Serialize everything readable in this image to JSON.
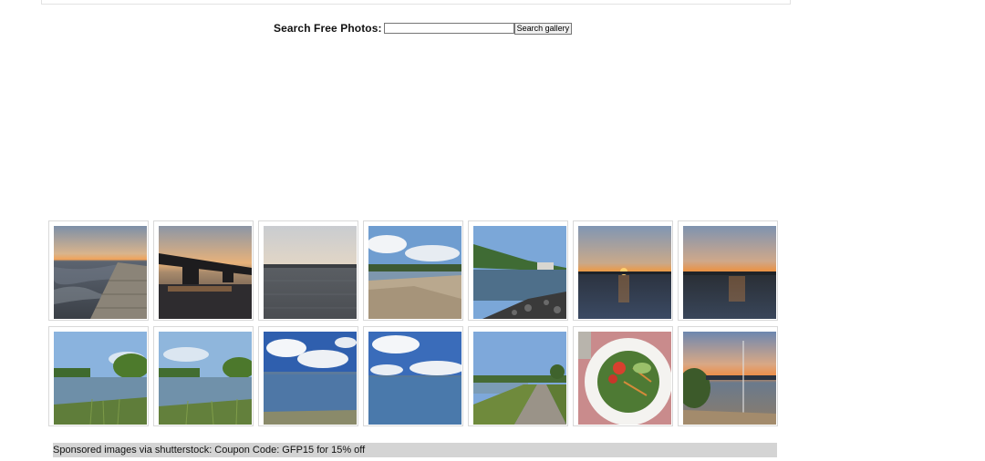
{
  "search": {
    "label": "Search Free Photos:",
    "value": "",
    "placeholder": "",
    "button_label": "Search gallery"
  },
  "gallery": {
    "rows": [
      [
        {
          "subject": "pier-sunset-lake"
        },
        {
          "subject": "bridge-sunset-reflection"
        },
        {
          "subject": "calm-lake-dusk"
        },
        {
          "subject": "sandy-shore-clouds"
        },
        {
          "subject": "rocky-shore-hill"
        },
        {
          "subject": "sun-setting-lake"
        },
        {
          "subject": "sunset-horizon-lake"
        }
      ],
      [
        {
          "subject": "reedy-lake-trees"
        },
        {
          "subject": "reedy-lake-trees-2"
        },
        {
          "subject": "blue-lake-clouds"
        },
        {
          "subject": "blue-lake-clouds-2"
        },
        {
          "subject": "gravel-path-lake"
        },
        {
          "subject": "salad-plate"
        },
        {
          "subject": "harbor-sunset"
        }
      ]
    ]
  },
  "sponsor": {
    "text": "Sponsored images via shutterstock: Coupon Code: GFP15 for 15% off"
  }
}
